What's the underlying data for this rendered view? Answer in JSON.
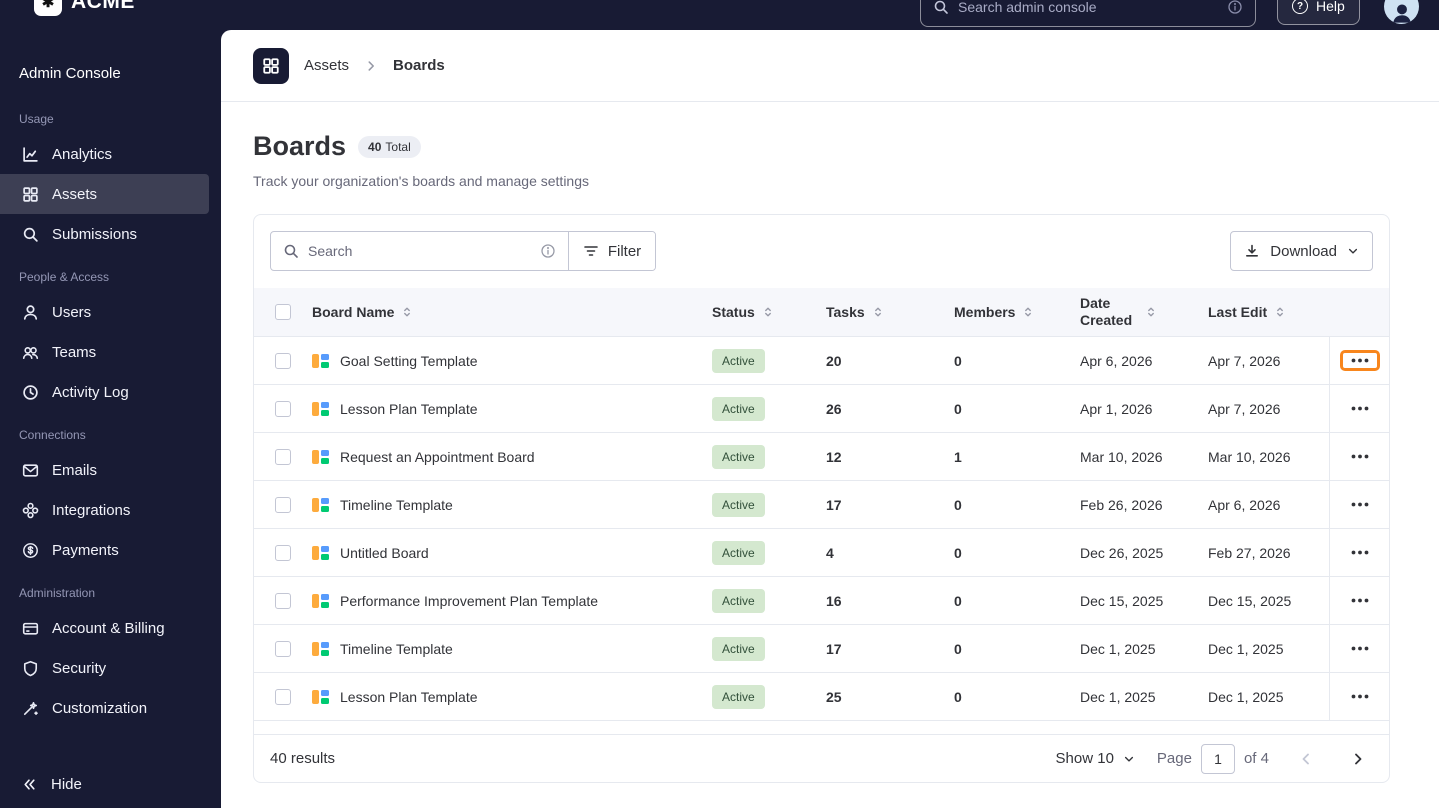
{
  "colors": {
    "navy": "#181b34",
    "highlight_orange": "#f8861d",
    "badge_green_bg": "#d4e8cf",
    "border": "#e6e9ef"
  },
  "topbar": {
    "logo_text": "ACME",
    "search_placeholder": "Search admin console",
    "help_label": "Help"
  },
  "sidebar": {
    "title": "Admin Console",
    "hide_label": "Hide",
    "sections": [
      {
        "label": "Usage",
        "items": [
          {
            "label": "Analytics"
          },
          {
            "label": "Assets"
          },
          {
            "label": "Submissions"
          }
        ]
      },
      {
        "label": "People & Access",
        "items": [
          {
            "label": "Users"
          },
          {
            "label": "Teams"
          },
          {
            "label": "Activity Log"
          }
        ]
      },
      {
        "label": "Connections",
        "items": [
          {
            "label": "Emails"
          },
          {
            "label": "Integrations"
          },
          {
            "label": "Payments"
          }
        ]
      },
      {
        "label": "Administration",
        "items": [
          {
            "label": "Account & Billing"
          },
          {
            "label": "Security"
          },
          {
            "label": "Customization"
          }
        ]
      }
    ]
  },
  "breadcrumb": {
    "root": "Assets",
    "current": "Boards"
  },
  "page": {
    "title": "Boards",
    "badge_count": "40",
    "badge_label": "Total",
    "subtitle": "Track your organization's boards and manage settings"
  },
  "toolbar": {
    "search_placeholder": "Search",
    "filter_label": "Filter",
    "download_label": "Download"
  },
  "table": {
    "headers": [
      "Board Name",
      "Status",
      "Tasks",
      "Members",
      "Date Created",
      "Last Edit"
    ],
    "rows": [
      {
        "name": "Goal Setting Template",
        "status": "Active",
        "tasks": "20",
        "members": "0",
        "created": "Apr 6, 2026",
        "edited": "Apr 7, 2026",
        "highlighted": true
      },
      {
        "name": "Lesson Plan Template",
        "status": "Active",
        "tasks": "26",
        "members": "0",
        "created": "Apr 1, 2026",
        "edited": "Apr 7, 2026",
        "highlighted": false
      },
      {
        "name": "Request an Appointment Board",
        "status": "Active",
        "tasks": "12",
        "members": "1",
        "created": "Mar 10, 2026",
        "edited": "Mar 10, 2026",
        "highlighted": false
      },
      {
        "name": "Timeline Template",
        "status": "Active",
        "tasks": "17",
        "members": "0",
        "created": "Feb 26, 2026",
        "edited": "Apr 6, 2026",
        "highlighted": false
      },
      {
        "name": "Untitled Board",
        "status": "Active",
        "tasks": "4",
        "members": "0",
        "created": "Dec 26, 2025",
        "edited": "Feb 27, 2026",
        "highlighted": false
      },
      {
        "name": "Performance Improvement Plan Template",
        "status": "Active",
        "tasks": "16",
        "members": "0",
        "created": "Dec 15, 2025",
        "edited": "Dec 15, 2025",
        "highlighted": false
      },
      {
        "name": "Timeline Template",
        "status": "Active",
        "tasks": "17",
        "members": "0",
        "created": "Dec 1, 2025",
        "edited": "Dec 1, 2025",
        "highlighted": false
      },
      {
        "name": "Lesson Plan Template",
        "status": "Active",
        "tasks": "25",
        "members": "0",
        "created": "Dec 1, 2025",
        "edited": "Dec 1, 2025",
        "highlighted": false
      }
    ]
  },
  "footer": {
    "results": "40 results",
    "show_label": "Show 10",
    "page_label": "Page",
    "page_value": "1",
    "of_label": "of 4"
  }
}
